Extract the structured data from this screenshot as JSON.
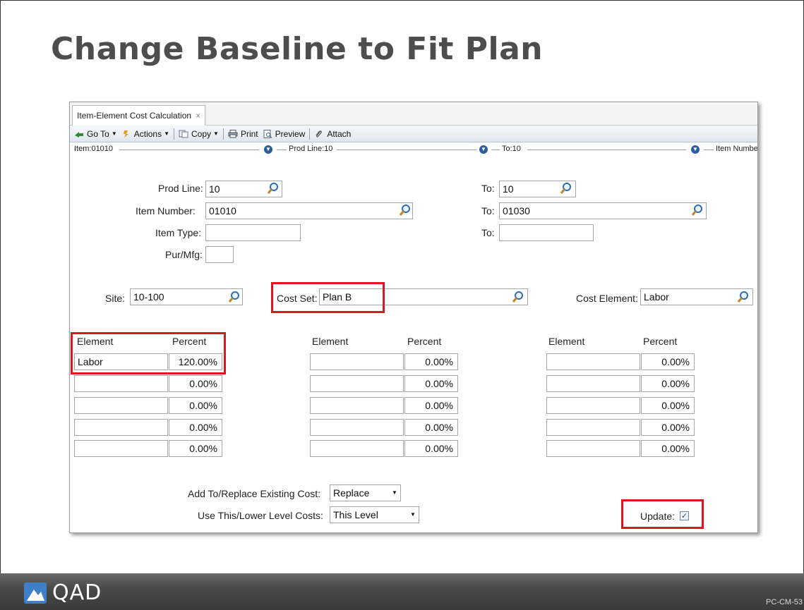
{
  "slide": {
    "title": "Change Baseline to Fit Plan",
    "footer_brand": "QAD",
    "footer_code": "PC-CM-53"
  },
  "window": {
    "tab_label": "Item-Element Cost Calculation",
    "tab_close": "×",
    "toolbar": {
      "goto": "Go To",
      "actions": "Actions",
      "copy": "Copy",
      "print": "Print",
      "preview": "Preview",
      "attach": "Attach"
    },
    "breadcrumbs": [
      "Item:01010",
      "Prod Line:10",
      "To:10",
      "Item Numbe"
    ],
    "form": {
      "prod_line": {
        "label": "Prod Line:",
        "value": "10"
      },
      "prod_line_to": {
        "label": "To:",
        "value": "10"
      },
      "item_number": {
        "label": "Item Number:",
        "value": "01010"
      },
      "item_number_to": {
        "label": "To:",
        "value": "01030"
      },
      "item_type": {
        "label": "Item Type:",
        "value": ""
      },
      "item_type_to": {
        "label": "To:",
        "value": ""
      },
      "pur_mfg": {
        "label": "Pur/Mfg:",
        "value": ""
      },
      "site": {
        "label": "Site:",
        "value": "10-100"
      },
      "cost_set": {
        "label": "Cost Set:",
        "value": "Plan B"
      },
      "cost_element": {
        "label": "Cost Element:",
        "value": "Labor"
      }
    },
    "element_columns": [
      {
        "element_header": "Element",
        "percent_header": "Percent",
        "rows": [
          {
            "element": "Labor",
            "percent": "120.00%"
          },
          {
            "element": "",
            "percent": "0.00%"
          },
          {
            "element": "",
            "percent": "0.00%"
          },
          {
            "element": "",
            "percent": "0.00%"
          },
          {
            "element": "",
            "percent": "0.00%"
          }
        ]
      },
      {
        "element_header": "Element",
        "percent_header": "Percent",
        "rows": [
          {
            "element": "",
            "percent": "0.00%"
          },
          {
            "element": "",
            "percent": "0.00%"
          },
          {
            "element": "",
            "percent": "0.00%"
          },
          {
            "element": "",
            "percent": "0.00%"
          },
          {
            "element": "",
            "percent": "0.00%"
          }
        ]
      },
      {
        "element_header": "Element",
        "percent_header": "Percent",
        "rows": [
          {
            "element": "",
            "percent": "0.00%"
          },
          {
            "element": "",
            "percent": "0.00%"
          },
          {
            "element": "",
            "percent": "0.00%"
          },
          {
            "element": "",
            "percent": "0.00%"
          },
          {
            "element": "",
            "percent": "0.00%"
          }
        ]
      }
    ],
    "options": {
      "add_replace": {
        "label": "Add To/Replace Existing Cost:",
        "value": "Replace"
      },
      "this_lower": {
        "label": "Use This/Lower Level Costs:",
        "value": "This Level"
      },
      "update": {
        "label": "Update:",
        "checked": true,
        "check_glyph": "✓"
      }
    }
  },
  "colors": {
    "highlight_red": "#d9181f",
    "title_gray": "#4d4d4d",
    "footer_dark": "#3a3a3a"
  }
}
